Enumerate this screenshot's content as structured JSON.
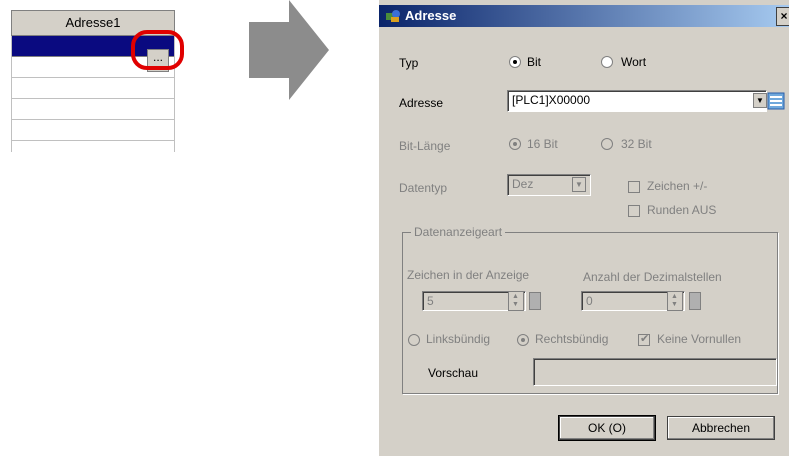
{
  "grid": {
    "header": "Adresse1",
    "ellipsis_label": "..."
  },
  "dialog": {
    "title": "Adresse",
    "close_label": "×",
    "typ": {
      "label": "Typ",
      "options": [
        "Bit",
        "Wort"
      ],
      "selected": "Bit"
    },
    "adresse": {
      "label": "Adresse",
      "value": "[PLC1]X00000"
    },
    "bit_laenge": {
      "label": "Bit-Länge",
      "options": [
        "16 Bit",
        "32 Bit"
      ],
      "selected": "16 Bit"
    },
    "datentyp": {
      "label": "Datentyp",
      "value": "Dez",
      "zeichen": "Zeichen +/-",
      "runden": "Runden AUS"
    },
    "datenanzeigeart": {
      "legend": "Datenanzeigeart",
      "zeichen_label": "Zeichen in der Anzeige",
      "zeichen_value": "5",
      "dezimal_label": "Anzahl der Dezimalstellen",
      "dezimal_value": "0",
      "align_options": [
        "Linksbündig",
        "Rechtsbündig"
      ],
      "align_selected": "Rechtsbündig",
      "keine_vornullen": "Keine Vornullen",
      "vorschau_label": "Vorschau"
    },
    "ok_label": "OK (O)",
    "cancel_label": "Abbrechen"
  },
  "colors": {
    "selection": "#0a0a80",
    "highlight_circle": "#e00000",
    "titlebar": "#0a246a"
  }
}
